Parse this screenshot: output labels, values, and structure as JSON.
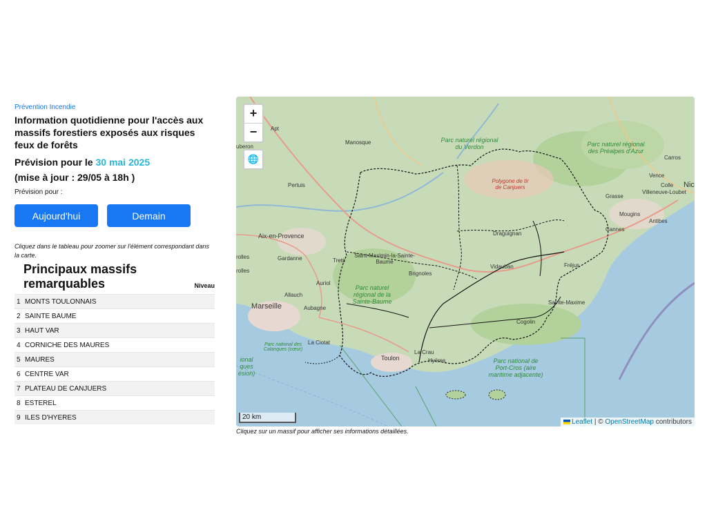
{
  "header": {
    "breadcrumb": "Prévention Incendie",
    "title": "Information quotidienne pour l'accès aux massifs forestiers exposés aux risques feux de forêts",
    "forecast_prefix": "Prévision pour le",
    "forecast_date": "30 mai 2025",
    "updated": "(mise à jour : 29/05 à 18h )",
    "forecast_for_label": "Prévision pour :"
  },
  "buttons": {
    "today": "Aujourd'hui",
    "tomorrow": "Demain"
  },
  "hint": "Cliquez dans le tableau pour zoomer sur l'élément correspondant dans la carte.",
  "table": {
    "heading": "Principaux massifs remarquables",
    "level_header": "Niveau",
    "rows": [
      {
        "num": "1",
        "name": "MONTS TOULONNAIS"
      },
      {
        "num": "2",
        "name": "SAINTE BAUME"
      },
      {
        "num": "3",
        "name": "HAUT VAR"
      },
      {
        "num": "4",
        "name": "CORNICHE DES MAURES"
      },
      {
        "num": "5",
        "name": "MAURES"
      },
      {
        "num": "6",
        "name": "CENTRE VAR"
      },
      {
        "num": "7",
        "name": "PLATEAU DE CANJUERS"
      },
      {
        "num": "8",
        "name": "ESTEREL"
      },
      {
        "num": "9",
        "name": "ILES D'HYERES"
      }
    ]
  },
  "map": {
    "zoom_in": "+",
    "zoom_out": "−",
    "layers_icon": "globe-icon",
    "scale": "20 km",
    "attribution": {
      "leaflet": "Leaflet",
      "sep": " | © ",
      "osm": "OpenStreetMap",
      "contributors": " contributors"
    },
    "note": "Cliquez sur un massif pour afficher ses informations détaillées.",
    "labels": {
      "apt": "Apt",
      "manosque": "Manosque",
      "luberon": "uberon",
      "pertuis": "Pertuis",
      "aix": "Aix-en-Provence",
      "gardanne": "Gardanne",
      "trets": "Trets",
      "auriol": "Auriol",
      "allauch": "Allauch",
      "aubagne": "Aubagne",
      "marseille": "Marseille",
      "laciotat": "La Ciotat",
      "toulon": "Toulon",
      "hyeres": "Hyères",
      "lacrau": "La Crau",
      "brignoles": "Brignoles",
      "stmaximin": "Saint-Maximin-la-Sainte-Baume",
      "draguignan": "Draguignan",
      "vidauban": "Vidauban",
      "stmaxime": "Sainte-Maxime",
      "cogolin": "Cogolin",
      "frejus": "Fréjus",
      "cannes": "Cannes",
      "grasse": "Grasse",
      "mougins": "Mougins",
      "antibes": "Antibes",
      "vence": "Vence",
      "villeneuve": "Villeneuve-Loubet",
      "carros": "Carros",
      "nice": "Nic",
      "colle": "Colle",
      "rolles": "rolles",
      "rolles2": "rolles",
      "park_verdon": "Parc naturel régional du Verdon",
      "park_prealpes": "Parc naturel régional des Préalpes d'Azur",
      "park_stbaume": "Parc naturel régional de la Sainte-Baume",
      "park_calanques": "Parc national des Calanques (cœur)",
      "park_portcros": "Parc national de Port-Cros (aire maritime adjacente)",
      "park_left": "ional ques ésion)",
      "polygone": "Polygone de tir de Canjuers"
    }
  }
}
